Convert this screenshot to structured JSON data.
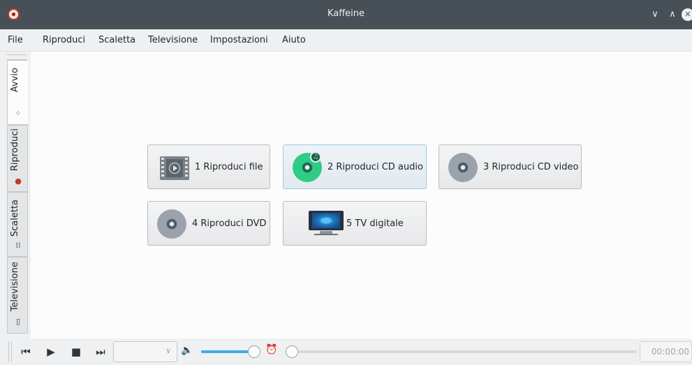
{
  "window": {
    "title": "Kaffeine",
    "controls": {
      "minimize": "∨",
      "maximize": "∧",
      "close": "✕"
    }
  },
  "menubar": {
    "items": [
      "File",
      "Riproduci",
      "Scaletta",
      "Televisione",
      "Impostazioni",
      "Aiuto"
    ]
  },
  "sidetabs": [
    {
      "label": "Avvio",
      "icon": "start-icon",
      "active": true
    },
    {
      "label": "Riproduci",
      "icon": "kaffeine-icon",
      "active": false
    },
    {
      "label": "Scaletta",
      "icon": "playlist-icon",
      "active": false
    },
    {
      "label": "Televisione",
      "icon": "tv-icon",
      "active": false
    }
  ],
  "start_buttons": [
    {
      "label": "1 Riproduci file",
      "icon": "video-file-icon"
    },
    {
      "label": "2 Riproduci CD audio",
      "icon": "audio-cd-icon"
    },
    {
      "label": "3 Riproduci CD video",
      "icon": "video-cd-icon"
    },
    {
      "label": "4 Riproduci DVD",
      "icon": "dvd-icon"
    },
    {
      "label": "5 TV digitale",
      "icon": "digital-tv-icon"
    }
  ],
  "toolbar": {
    "previous_icon": "⏮",
    "play_icon": "▶",
    "stop_icon": "■",
    "next_icon": "⏭",
    "chevron": "∨",
    "volume_icon": "🔈",
    "alarm_icon": "⏰",
    "volume_fraction": 0.9,
    "seek_fraction": 0,
    "time": "00:00:00"
  },
  "colors": {
    "titlebar": "#475057",
    "window_bg": "#eff0f1",
    "content_bg": "#fcfcfc",
    "accent": "#3daee9"
  }
}
